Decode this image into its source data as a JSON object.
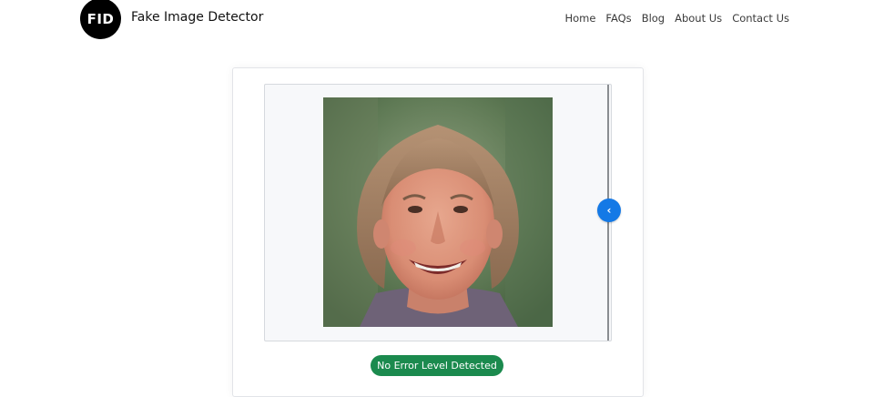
{
  "header": {
    "logo_text": "FID",
    "brand_name": "Fake Image Detector",
    "nav": [
      "Home",
      "FAQs",
      "Blog",
      "About Us",
      "Contact Us"
    ]
  },
  "result": {
    "status_label": "No Error Level Detected",
    "status_color": "#1b8a4e"
  },
  "comparison_slider": {
    "handle_icon": "chevron-left-icon",
    "handle_color": "#1479e6"
  }
}
